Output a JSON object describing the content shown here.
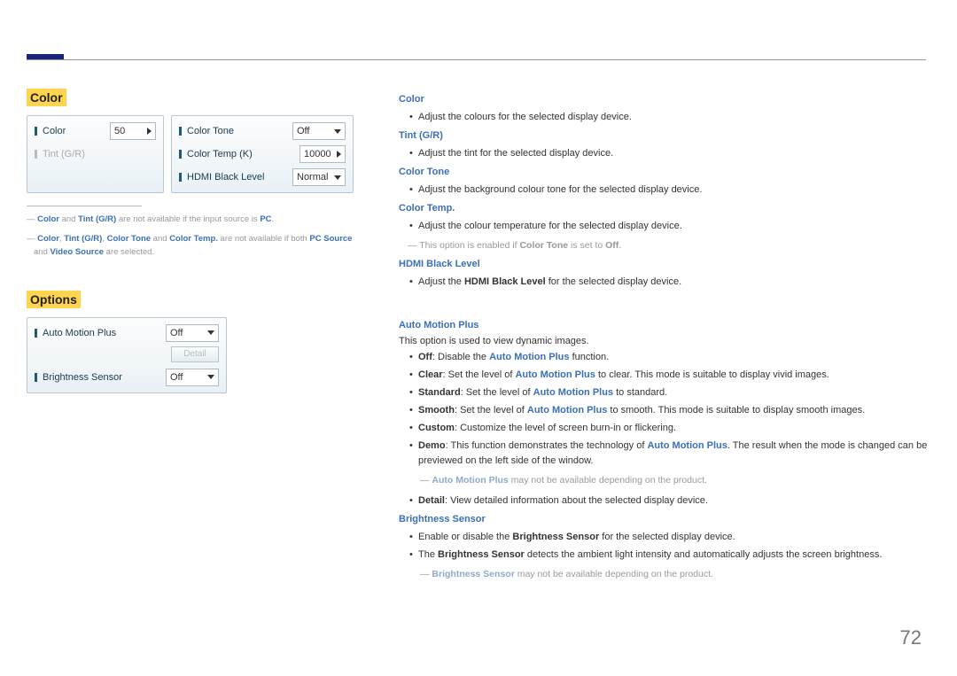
{
  "page_number": "72",
  "left": {
    "sec_color": "Color",
    "sec_options": "Options",
    "panel_color": {
      "color_label": "Color",
      "color_value": "50",
      "tint_label": "Tint (G/R)",
      "ctone_label": "Color Tone",
      "ctone_value": "Off",
      "ctemp_label": "Color Temp (K)",
      "ctemp_value": "10000",
      "hdmi_label": "HDMI Black Level",
      "hdmi_value": "Normal"
    },
    "panel_options": {
      "amp_label": "Auto Motion Plus",
      "amp_value": "Off",
      "detail_btn": "Detail",
      "bs_label": "Brightness Sensor",
      "bs_value": "Off"
    },
    "fn1": {
      "pre": "― ",
      "a": "Color",
      "mid": " and ",
      "b": "Tint (G/R)",
      "tail": " are not available if the input source is ",
      "c": "PC",
      "dot": "."
    },
    "fn2": {
      "pre": "― ",
      "a": "Color",
      "c1": ", ",
      "b": "Tint (G/R)",
      "c2": ", ",
      "c": "Color Tone",
      "mid": " and ",
      "d": "Color Temp.",
      "tail": " are not available if both ",
      "e": "PC Source",
      "and2": " and ",
      "f": "Video Source",
      "end": " are selected."
    }
  },
  "right": {
    "color": {
      "head": "Color",
      "b1": "Adjust the colours for the selected display device."
    },
    "tint": {
      "head": "Tint (G/R)",
      "b1": "Adjust the tint for the selected display device."
    },
    "ctone": {
      "head": "Color Tone",
      "b1": "Adjust the background colour tone for the selected display device."
    },
    "ctemp": {
      "head": "Color Temp.",
      "b1": "Adjust the colour temperature for the selected display device.",
      "note_pre": "― This option is enabled if ",
      "note_bold": "Color Tone",
      "note_mid": " is set to ",
      "note_off": "Off",
      "note_dot": "."
    },
    "hdmi": {
      "head": "HDMI Black Level",
      "b1_pre": "Adjust the ",
      "b1_bold": "HDMI Black Level",
      "b1_post": " for the selected display device."
    },
    "amp": {
      "head": "Auto Motion Plus",
      "intro": "This option is used to view dynamic images.",
      "off_label": "Off",
      "off_text": ": Disable the ",
      "off_target": "Auto Motion Plus",
      "off_post": " function.",
      "clear_label": "Clear",
      "clear_text": ": Set the level of ",
      "clear_target": "Auto Motion Plus",
      "clear_post": " to clear. This mode is suitable to display vivid images.",
      "std_label": "Standard",
      "std_text": ": Set the level of ",
      "std_target": "Auto Motion Plus",
      "std_post": " to standard.",
      "smooth_label": "Smooth",
      "smooth_text": ": Set the level of ",
      "smooth_target": "Auto Motion Plus",
      "smooth_post": " to smooth. This mode is suitable to display smooth images.",
      "custom_label": "Custom",
      "custom_text": ": Customize the level of screen burn-in or flickering.",
      "demo_label": "Demo",
      "demo_text": ": This function demonstrates the technology of ",
      "demo_target": "Auto Motion Plus",
      "demo_post": ". The result when the mode is changed can be previewed on the left side of the window.",
      "note_pre": "― ",
      "note_target": "Auto Motion Plus",
      "note_post": " may not be available depending on the product.",
      "detail_label": "Detail",
      "detail_text": ": View detailed information about the selected display device."
    },
    "bs": {
      "head": "Brightness Sensor",
      "b1_pre": "Enable or disable the ",
      "b1_bold": "Brightness Sensor",
      "b1_post": " for the selected display device.",
      "b2_pre": "The ",
      "b2_bold": "Brightness Sensor",
      "b2_post": " detects the ambient light intensity and automatically adjusts the screen brightness.",
      "note_pre": "― ",
      "note_target": "Brightness Sensor",
      "note_post": " may not be available depending on the product."
    }
  }
}
